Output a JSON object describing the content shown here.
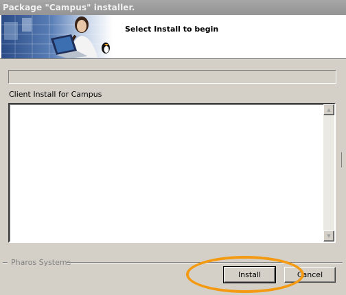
{
  "window": {
    "title": "Package \"Campus\" installer."
  },
  "header": {
    "title": "Select Install to begin"
  },
  "progress": {
    "value": 0
  },
  "section": {
    "label": "Client Install for Campus"
  },
  "log": {
    "text": ""
  },
  "footer": {
    "brand": "Pharos Systems"
  },
  "buttons": {
    "install": "Install",
    "cancel": "Cancel"
  },
  "colors": {
    "highlight": "#f39a12",
    "banner": "#2a4b86"
  },
  "icons": {
    "scroll_up": "triangle-up",
    "scroll_down": "triangle-down"
  }
}
